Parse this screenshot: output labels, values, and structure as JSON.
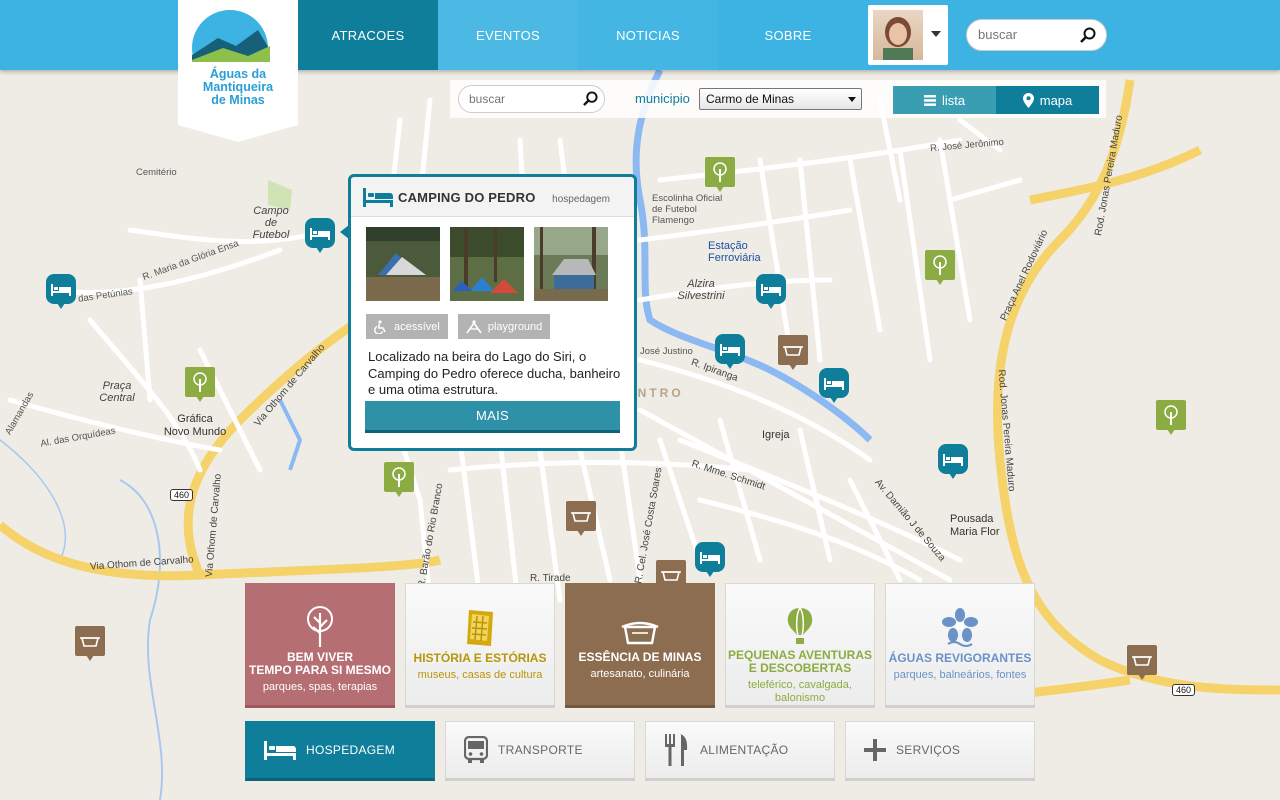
{
  "brand": {
    "logo_line1": "Águas da",
    "logo_line2": "Mantiqueira",
    "logo_line3": "de Minas"
  },
  "nav": [
    {
      "label": "ATRACOES",
      "active": true
    },
    {
      "label": "EVENTOS"
    },
    {
      "label": "NOTICIAS"
    },
    {
      "label": "SOBRE"
    }
  ],
  "top_search": {
    "placeholder": "buscar"
  },
  "subbar": {
    "search_placeholder": "buscar",
    "municipio_label": "municipio",
    "municipio_value": "Carmo de Minas",
    "view_lista": "lista",
    "view_mapa": "mapa"
  },
  "popup": {
    "title": "CAMPING DO PEDRO",
    "category": "hospedagem",
    "tags": [
      "acessível",
      "playground"
    ],
    "description": "Localizado na beira do Lago do Siri, o Camping do Pedro oferece ducha, banheiro e uma otima estrutura.",
    "button": "MAIS"
  },
  "tiles": [
    {
      "title": "BEM VIVER\nTEMPO PARA SI MESMO",
      "sub": "parques, spas, terapias"
    },
    {
      "title": "HISTÓRIA E ESTÓRIAS",
      "sub": "museus, casas de cultura"
    },
    {
      "title": "ESSÊNCIA DE MINAS",
      "sub": "artesanato, culinária"
    },
    {
      "title": "PEQUENAS AVENTURAS\nE DESCOBERTAS",
      "sub": "teleférico, cavalgada, balonismo"
    },
    {
      "title": "ÁGUAS REVIGORANTES",
      "sub": "parques, balneários, fontes"
    }
  ],
  "services": [
    {
      "label": "HOSPEDAGEM",
      "active": true
    },
    {
      "label": "TRANSPORTE"
    },
    {
      "label": "ALIMENTAÇÃO"
    },
    {
      "label": "SERVIÇOS"
    }
  ],
  "map_labels": {
    "cemiterio": "Cemitério",
    "campo": "Campo de\nFutebol",
    "praca": "Praça\nCentral",
    "grafica": "Gráfica\nNovo Mundo",
    "estacao": "Estação\nFerroviária",
    "alzira": "Alzira\nSilvestrini",
    "escolinha": "Escolinha Oficial\nde Futebol\nFlamengo",
    "igreja": "Igreja",
    "pousada": "Pousada\nMaria Flor",
    "centro": "CENTRO",
    "r_petunias": "das Petúnias",
    "r_gloria": "R. Maria da Glória Ensa",
    "r_orquideas": "Al. das Orquídeas",
    "r_alamandas": "Alamandas",
    "via_othom1": "Via Othom de Carvalho",
    "via_othom2": "Via Othom de Carvalho",
    "via_othom3": "Via Othom de Carvalho",
    "rod_jonas1": "Rod. Jonas Pereira Maduro",
    "rod_jonas2": "Rod. Jonas Pereira Maduro",
    "praca_anel": "Praça Anel Rodoviário",
    "av_damiao": "Av. Damião J de Souza",
    "r_schmidt": "R. Mme. Schmidt",
    "r_ipiranga": "R. Ipiranga",
    "r_jeronimo": "R. José Jerônimo",
    "r_jose_justino": "José Justino",
    "r_costa_soares": "R. Cel. José Costa Soares",
    "r_tirade": "R. Tirade",
    "r_rio_branco": "R. Barão do Rio Branco",
    "shield_460a": "460",
    "shield_460b": "460"
  }
}
